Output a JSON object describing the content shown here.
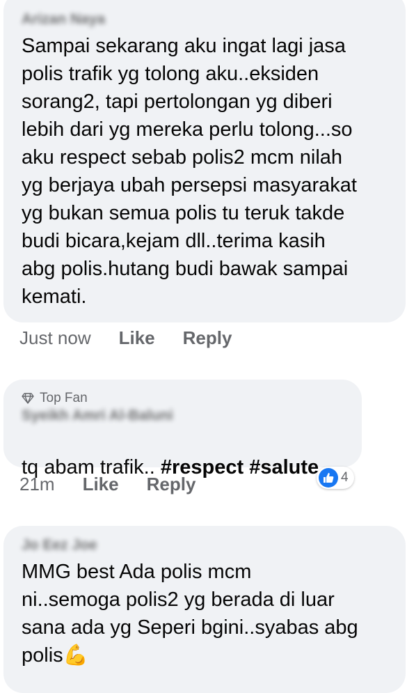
{
  "comments": [
    {
      "author": "Arizan Naya",
      "text": "Sampai sekarang aku ingat lagi jasa\npolis trafik yg tolong aku..eksiden\nsorang2, tapi pertolongan yg diberi\nlebih dari yg mereka perlu tolong...so\naku respect sebab polis2 mcm nilah\nyg berjaya ubah persepsi masyarakat\nyg bukan semua polis tu teruk takde\nbudi bicara,kejam dll..terima kasih\nabg polis.hutang budi bawak sampai\nkemati.",
      "time": "Just now",
      "like_label": "Like",
      "reply_label": "Reply"
    },
    {
      "badge": "Top Fan",
      "badge_icon": "diamond-icon",
      "author": "Syeikh Amri Al-Baluni",
      "text_prefix": "tq abam trafik.. ",
      "tags": [
        "#respect",
        "#salute"
      ],
      "time": "21m",
      "like_label": "Like",
      "reply_label": "Reply",
      "reaction_icon": "like-icon",
      "reaction_count": "4"
    },
    {
      "author": "Jo Eez Joe",
      "text": "MMG best Ada polis mcm\nni..semoga polis2 yg berada di luar\nsana ada yg Seperi bgini..syabas abg\npolis",
      "emoji": "💪"
    }
  ],
  "colors": {
    "bubble": "#f0f2f5",
    "meta": "#65676b",
    "like_blue": "#1877f2"
  }
}
